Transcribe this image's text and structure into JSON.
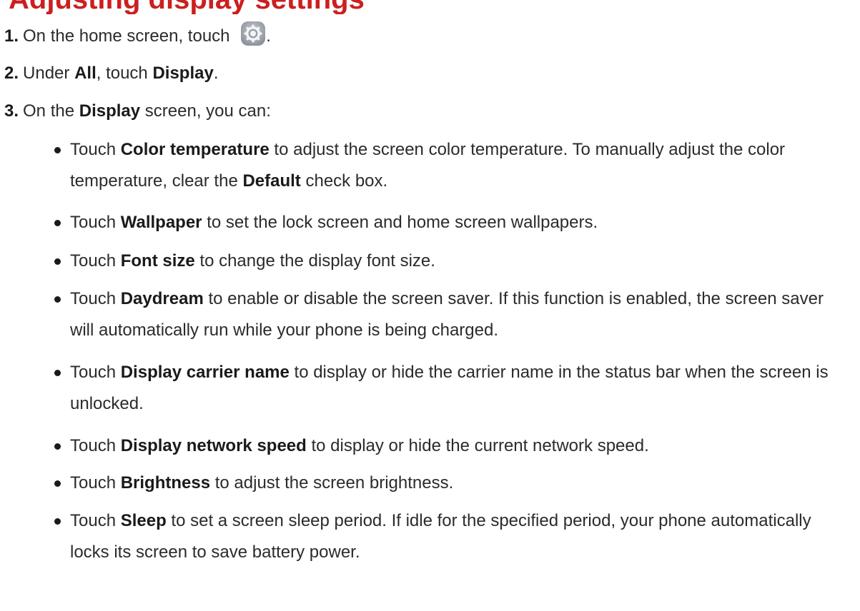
{
  "heading": "Adjusting display settings",
  "steps": [
    {
      "num": "1.",
      "pre": "On the home screen, touch",
      "post": "."
    },
    {
      "num": "2.",
      "pre": "Under ",
      "b1": "All",
      "mid": ", touch ",
      "b2": "Display",
      "post": "."
    },
    {
      "num": "3.",
      "pre": "On the ",
      "b1": "Display",
      "post": " screen, you can:"
    }
  ],
  "bullets": [
    {
      "pre": "Touch ",
      "bold": "Color temperature",
      "text": " to adjust the screen color temperature. To manually adjust the color temperature, clear the ",
      "bold2": "Default",
      "text2": " check box."
    },
    {
      "pre": "Touch ",
      "bold": "Wallpaper",
      "text": " to set the lock screen and home screen wallpapers."
    },
    {
      "pre": "Touch ",
      "bold": "Font size",
      "text": " to change the display font size."
    },
    {
      "pre": "Touch ",
      "bold": "Daydream",
      "text": " to enable or disable the screen saver. If this function is enabled, the screen saver will automatically run while your phone is being charged."
    },
    {
      "pre": "Touch ",
      "bold": "Display carrier name",
      "text": " to display or hide the carrier name in the status bar when the screen is unlocked."
    },
    {
      "pre": "Touch ",
      "bold": "Display network speed",
      "text": " to display or hide the current network speed."
    },
    {
      "pre": "Touch ",
      "bold": "Brightness",
      "text": " to adjust the screen brightness."
    },
    {
      "pre": "Touch ",
      "bold": "Sleep",
      "text": " to set a screen sleep period. If idle for the specified period, your phone automatically locks its screen to save battery power."
    }
  ]
}
